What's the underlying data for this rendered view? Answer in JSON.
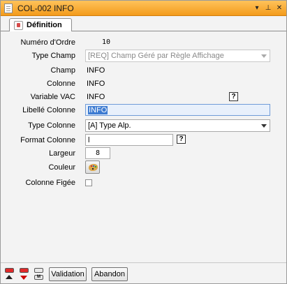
{
  "window": {
    "title": "COL-002 INFO",
    "controls": {
      "pin": "▾",
      "dock": "ᵖ",
      "close": "✕"
    }
  },
  "tab": {
    "label": "Définition"
  },
  "form": {
    "numero_ordre": {
      "label": "Numéro d'Ordre",
      "value": "10"
    },
    "type_champ": {
      "label": "Type Champ",
      "value": "[REQ] Champ Géré par Règle Affichage"
    },
    "champ": {
      "label": "Champ",
      "value": "INFO"
    },
    "colonne": {
      "label": "Colonne",
      "value": "INFO"
    },
    "variable_vac": {
      "label": "Variable VAC",
      "value": "INFO",
      "help": "?"
    },
    "libelle_colonne": {
      "label": "Libellé Colonne",
      "value": "INFO"
    },
    "type_colonne": {
      "label": "Type Colonne",
      "value": "[A] Type Alp."
    },
    "format_colonne": {
      "label": "Format Colonne",
      "value": "l",
      "help": "?"
    },
    "largeur": {
      "label": "Largeur",
      "value": "8"
    },
    "couleur": {
      "label": "Couleur"
    },
    "colonne_figee": {
      "label": "Colonne Figée",
      "checked": false
    }
  },
  "footer": {
    "validation_label": "Validation",
    "abandon_label": "Abandon"
  },
  "colors": {
    "titlebar": "#f39b1b",
    "focus": "#3d7bd1"
  }
}
